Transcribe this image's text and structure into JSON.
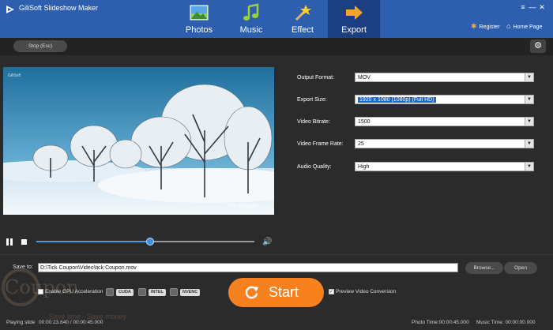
{
  "app": {
    "title": "GiliSoft Slideshow Maker",
    "register": "Register",
    "home_page": "Home Page",
    "accent": "#2e5fae"
  },
  "tabs": [
    {
      "label": "Photos",
      "icon": "photos-icon"
    },
    {
      "label": "Music",
      "icon": "music-note-icon"
    },
    {
      "label": "Effect",
      "icon": "magic-wand-icon"
    },
    {
      "label": "Export",
      "icon": "arrow-right-icon",
      "active": true
    }
  ],
  "toolbar": {
    "stop_label": "Stop (Esc)",
    "settings_icon": "gear-icon"
  },
  "preview": {
    "watermark": "Tick Coupon",
    "logo_text": "GiliSoft",
    "position": 0.52
  },
  "settings": {
    "output_format": {
      "label": "Output Format:",
      "value": "MOV"
    },
    "export_size": {
      "label": "Export Size:",
      "value": "1920 x 1080 (1080p) (Full HD)"
    },
    "video_bitrate": {
      "label": "Video Bitrate:",
      "value": "1500"
    },
    "frame_rate": {
      "label": "Video Frame Rate:",
      "value": "25"
    },
    "audio_quality": {
      "label": "Audio Quality:",
      "value": "High"
    }
  },
  "save": {
    "label": "Save to:",
    "path": "D:\\Tick Coupon\\Video\\tick Coupon.mov",
    "browse": "Browse...",
    "open": "Open"
  },
  "gpu": {
    "label": "Enable GPU Acceleration",
    "chips": [
      "CUDA",
      "INTEL",
      "NVENC"
    ]
  },
  "start": {
    "label": "Start",
    "color": "#f7801f"
  },
  "preview_conversion": {
    "label": "Preview Video Conversion",
    "checked": true
  },
  "watermark_overlay": {
    "brand": "Coupon",
    "tagline": "Save time - Save money"
  },
  "status": {
    "state": "Playing slide",
    "time": "00:00:23.640 / 00:00:45.000",
    "photo_time": "Photo Time:00:00:45.000",
    "music_time": "Music Time: 00:00:00.000"
  }
}
